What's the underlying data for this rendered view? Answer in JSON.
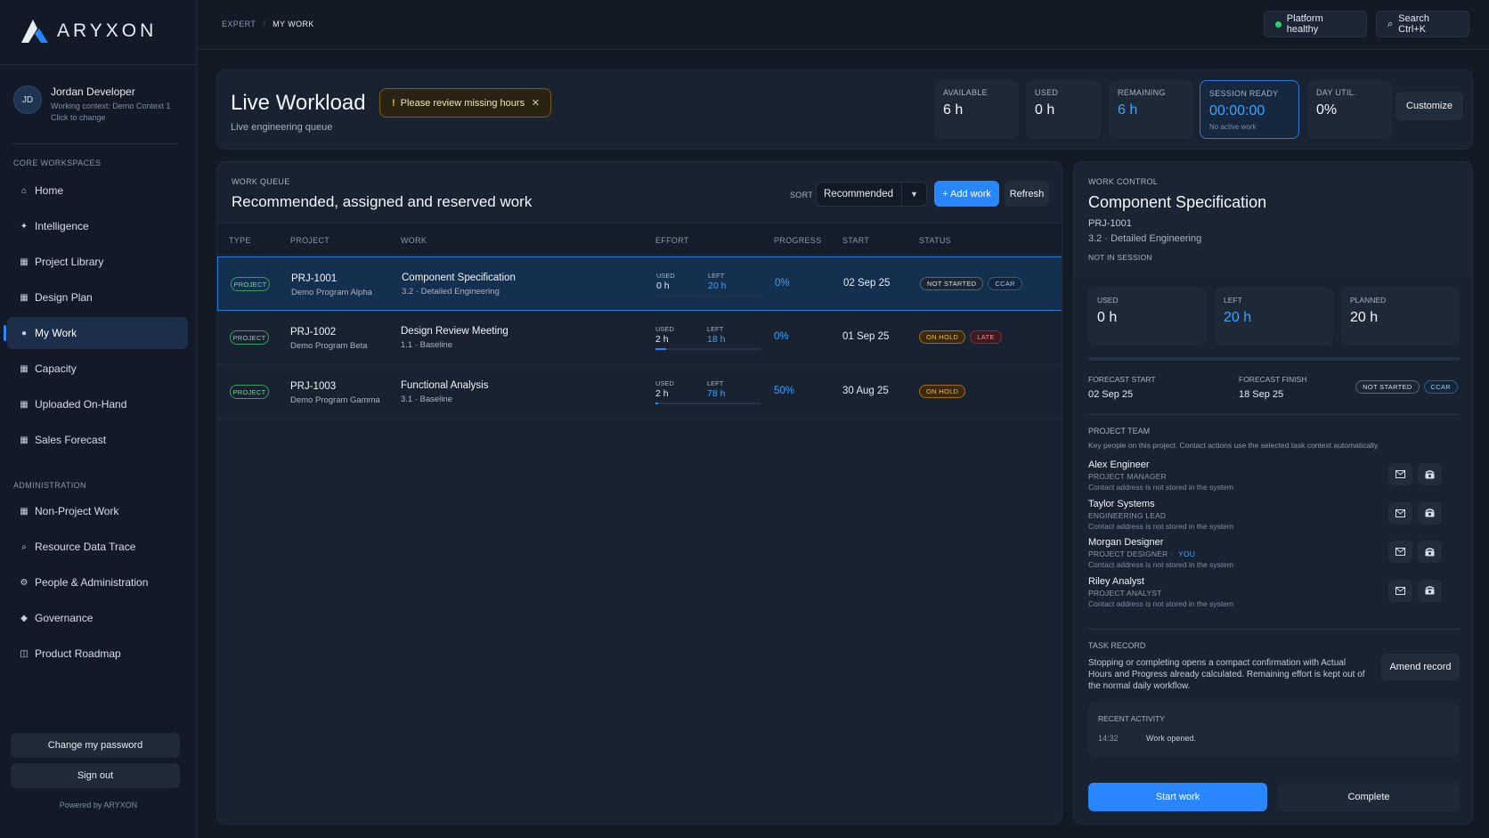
{
  "brand": {
    "name": "ARYXON",
    "powered_by": "Powered by ARYXON"
  },
  "user": {
    "initials": "JD",
    "name": "Jordan Developer",
    "context": "Working context: Demo Context 1",
    "change_hint": "Click to change"
  },
  "sidebar": {
    "core_label": "CORE WORKSPACES",
    "core_items": [
      {
        "label": "Home",
        "icon": "home-icon",
        "glyph": "⌂"
      },
      {
        "label": "Intelligence",
        "icon": "sparkle-icon",
        "glyph": "✦"
      },
      {
        "label": "Project Library",
        "icon": "grid-icon",
        "glyph": "▦"
      },
      {
        "label": "Design Plan",
        "icon": "grid-icon",
        "glyph": "▦"
      },
      {
        "label": "My Work",
        "icon": "dot-icon",
        "glyph": "●"
      },
      {
        "label": "Capacity",
        "icon": "grid-icon",
        "glyph": "▦"
      },
      {
        "label": "Uploaded On-Hand",
        "icon": "grid-icon",
        "glyph": "▦"
      },
      {
        "label": "Sales Forecast",
        "icon": "grid-icon",
        "glyph": "▦"
      }
    ],
    "admin_label": "ADMINISTRATION",
    "admin_items": [
      {
        "label": "Non-Project Work",
        "icon": "grid-icon",
        "glyph": "▦"
      },
      {
        "label": "Resource Data Trace",
        "icon": "search-icon",
        "glyph": "⌕"
      },
      {
        "label": "People & Administration",
        "icon": "gear-icon",
        "glyph": "⚙"
      },
      {
        "label": "Governance",
        "icon": "diamond-icon",
        "glyph": "◆"
      },
      {
        "label": "Product Roadmap",
        "icon": "columns-icon",
        "glyph": "◫"
      }
    ],
    "change_password": "Change my password",
    "sign_out": "Sign out"
  },
  "topbar": {
    "breadcrumb": [
      "EXPERT",
      "MY WORK"
    ],
    "health": "Platform healthy",
    "search": "Search Ctrl+K"
  },
  "header": {
    "title": "Live Workload",
    "subtitle": "Live engineering queue",
    "warning": "Please review missing hours",
    "stats": [
      {
        "label": "AVAILABLE",
        "value": "6 h"
      },
      {
        "label": "USED",
        "value": "0 h"
      },
      {
        "label": "REMAINING",
        "value": "6 h"
      },
      {
        "label": "SESSION READY",
        "value": "00:00:00",
        "note": "No active work"
      },
      {
        "label": "DAY UTIL.",
        "value": "0%"
      }
    ],
    "customize": "Customize"
  },
  "queue": {
    "label": "WORK QUEUE",
    "title": "Recommended, assigned and reserved work",
    "sort_label": "SORT",
    "sort_value": "Recommended",
    "add_label": "+ Add work",
    "refresh_label": "Refresh",
    "columns": [
      "TYPE",
      "PROJECT",
      "WORK",
      "EFFORT",
      "PROGRESS",
      "START",
      "STATUS"
    ],
    "rows": [
      {
        "type": "PROJECT",
        "project": "PRJ-1001",
        "program": "Demo Program Alpha",
        "work": "Component Specification",
        "phase": "3.2 · Detailed Engineering",
        "used_label": "USED",
        "used": "0 h",
        "left_label": "LEFT",
        "left": "20 h",
        "used_fraction": 0.0,
        "progress": "0%",
        "start": "02 Sep 25",
        "statuses": [
          {
            "text": "NOT STARTED",
            "kind": "ns"
          },
          {
            "text": "CCAR",
            "kind": "ccar"
          }
        ]
      },
      {
        "type": "PROJECT",
        "project": "PRJ-1002",
        "program": "Demo Program Beta",
        "work": "Design Review Meeting",
        "phase": "1.1 · Baseline",
        "used_label": "USED",
        "used": "2 h",
        "left_label": "LEFT",
        "left": "18 h",
        "used_fraction": 0.1,
        "progress": "0%",
        "start": "01 Sep 25",
        "statuses": [
          {
            "text": "ON HOLD",
            "kind": "hold"
          },
          {
            "text": "LATE",
            "kind": "late"
          }
        ]
      },
      {
        "type": "PROJECT",
        "project": "PRJ-1003",
        "program": "Demo Program Gamma",
        "work": "Functional Analysis",
        "phase": "3.1 · Baseline",
        "used_label": "USED",
        "used": "2 h",
        "left_label": "LEFT",
        "left": "78 h",
        "used_fraction": 0.025,
        "progress": "50%",
        "start": "30 Aug 25",
        "statuses": [
          {
            "text": "ON HOLD",
            "kind": "hold"
          }
        ]
      }
    ]
  },
  "control": {
    "label": "WORK CONTROL",
    "title": "Component Specification",
    "project": "PRJ-1001",
    "phase": "3.2 · Detailed Engineering",
    "session": "NOT IN SESSION",
    "metrics": [
      {
        "label": "USED",
        "value": "0 h"
      },
      {
        "label": "LEFT",
        "value": "20 h"
      },
      {
        "label": "PLANNED",
        "value": "20 h"
      }
    ],
    "forecast_start_label": "FORECAST START",
    "forecast_start": "02 Sep 25",
    "forecast_finish_label": "FORECAST FINISH",
    "forecast_finish": "18 Sep 25",
    "badges": [
      "NOT STARTED",
      "CCAR"
    ],
    "team_label": "PROJECT TEAM",
    "team_desc": "Key people on this project. Contact actions use the selected task context automatically.",
    "team": [
      {
        "name": "Alex Engineer",
        "role": "PROJECT MANAGER",
        "you": "",
        "contact": "Contact address is not stored in the system"
      },
      {
        "name": "Taylor Systems",
        "role": "ENGINEERING LEAD",
        "you": "",
        "contact": "Contact address is not stored in the system"
      },
      {
        "name": "Morgan Designer",
        "role": "PROJECT DESIGNER ·",
        "you": "YOU",
        "contact": "Contact address is not stored in the system"
      },
      {
        "name": "Riley Analyst",
        "role": "PROJECT ANALYST",
        "you": "",
        "contact": "Contact address is not stored in the system"
      }
    ],
    "record_label": "TASK RECORD",
    "record_desc": "Stopping or completing opens a compact confirmation with Actual Hours and Progress already calculated. Remaining effort is kept out of the normal daily workflow.",
    "amend": "Amend record",
    "activity_label": "RECENT ACTIVITY",
    "activity_time": "14:32",
    "activity_text": "Work opened.",
    "start": "Start work",
    "complete": "Complete"
  },
  "colors": {
    "accent": "#2a86ff",
    "bg": "#121a26",
    "panel": "#182231"
  }
}
